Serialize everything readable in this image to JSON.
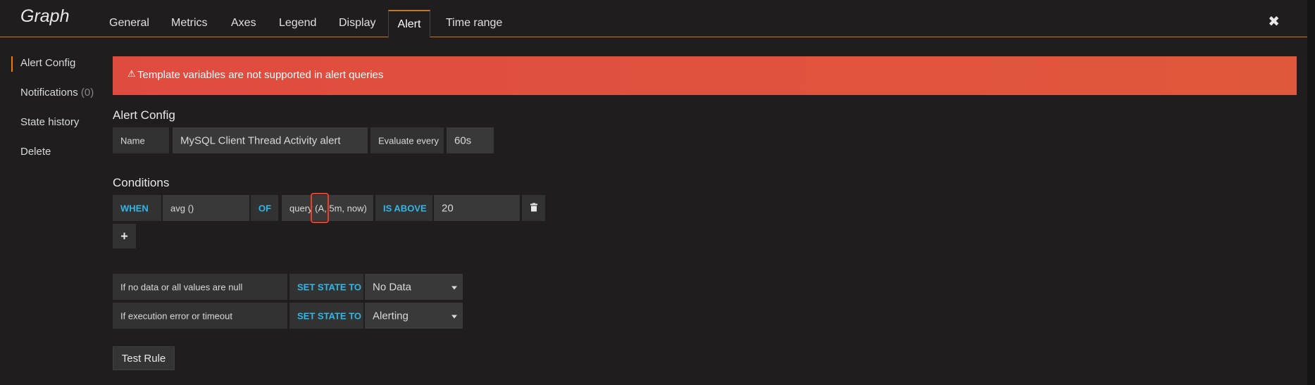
{
  "panel": {
    "title": "Graph"
  },
  "tabs": [
    {
      "label": "General"
    },
    {
      "label": "Metrics"
    },
    {
      "label": "Axes"
    },
    {
      "label": "Legend"
    },
    {
      "label": "Display"
    },
    {
      "label": "Alert"
    },
    {
      "label": "Time range"
    }
  ],
  "sidebar": {
    "items": [
      {
        "label": "Alert Config"
      },
      {
        "label": "Notifications",
        "count": "(0)"
      },
      {
        "label": "State history"
      },
      {
        "label": "Delete"
      }
    ]
  },
  "banner": {
    "text": "Template variables are not supported in alert queries",
    "color": "#e04b3f"
  },
  "alert_config": {
    "title": "Alert Config",
    "name_label": "Name",
    "name_value": "MySQL Client Thread Activity alert",
    "evaluate_label": "Evaluate every",
    "evaluate_value": "60s"
  },
  "conditions": {
    "title": "Conditions",
    "when": "WHEN",
    "reducer": "avg ()",
    "of": "OF",
    "query": "query (A, 5m, now)",
    "evaluator": "IS ABOVE",
    "threshold": "20"
  },
  "no_data": {
    "label": "If no data or all values are null",
    "set_state": "SET STATE TO",
    "value": "No Data"
  },
  "exec_error": {
    "label": "If execution error or timeout",
    "set_state": "SET STATE TO",
    "value": "Alerting"
  },
  "test_rule": {
    "label": "Test Rule"
  },
  "colors": {
    "accent": "#eb7b18",
    "keyword": "#33b5e5",
    "error": "#e04b3f"
  }
}
